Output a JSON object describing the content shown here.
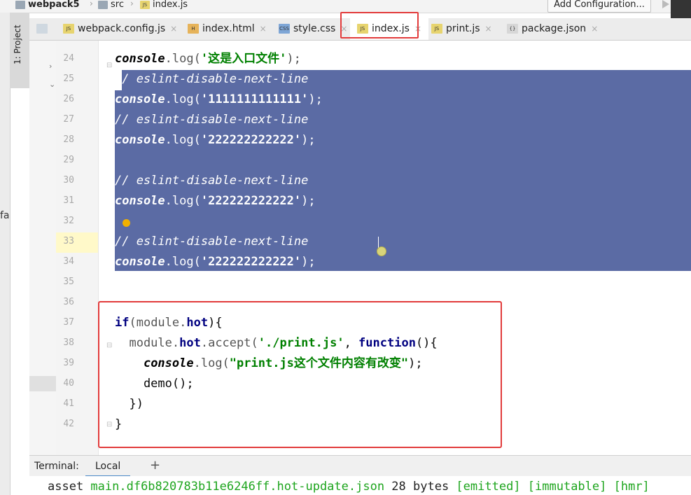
{
  "breadcrumb": [
    "webpack5",
    "src",
    "index.js"
  ],
  "toolbar": {
    "add_configuration": "Add Configuration..."
  },
  "sidebar": {
    "project_label": "1: Project",
    "partial_text": "fa"
  },
  "tabs": [
    {
      "label": "webpack.config.js",
      "icon": "js-file-icon"
    },
    {
      "label": "index.html",
      "icon": "html-file-icon"
    },
    {
      "label": "style.css",
      "icon": "css-file-icon"
    },
    {
      "label": "index.js",
      "icon": "js-file-icon",
      "active": true
    },
    {
      "label": "print.js",
      "icon": "js-file-icon"
    },
    {
      "label": "package.json",
      "icon": "json-file-icon"
    }
  ],
  "tab_close_symbol": "×",
  "editor": {
    "line_numbers": [
      "24",
      "25",
      "26",
      "27",
      "28",
      "29",
      "30",
      "31",
      "32",
      "33",
      "34",
      "35",
      "36",
      "37",
      "38",
      "39",
      "40",
      "41",
      "42"
    ],
    "code": {
      "l24_obj": "console",
      "l24_fn": ".log(",
      "l24_str": "'这是入口文件'",
      "l24_end": ");",
      "l25_cmt": "// eslint-disable-next-line",
      "l26_obj": "console",
      "l26_fn": ".log(",
      "l26_str": "'1111111111111'",
      "l26_end": ");",
      "l27_cmt": "// eslint-disable-next-line",
      "l28_obj": "console",
      "l28_fn": ".log(",
      "l28_str": "'222222222222'",
      "l28_end": ");",
      "l30_cmt": "// eslint-disable-next-line",
      "l31_obj": "console",
      "l31_fn": ".log(",
      "l31_str": "'222222222222'",
      "l31_end": ");",
      "l33_cmt": "// eslint-disable-next-line",
      "l34_obj": "console",
      "l34_fn": ".log(",
      "l34_str": "'222222222222'",
      "l34_end": ");",
      "l37_kw": "if",
      "l37_rest": "(module.",
      "l37_hot": "hot",
      "l37_end": "){",
      "l38_a": "  module.",
      "l38_hot": "hot",
      "l38_b": ".accept(",
      "l38_str": "'./print.js'",
      "l38_c": ", ",
      "l38_kw": "function",
      "l38_d": "(){",
      "l39_pre": "    ",
      "l39_obj": "console",
      "l39_fn": ".log(",
      "l39_str": "\"print.js这个文件内容有改变\"",
      "l39_end": ");",
      "l40": "    demo();",
      "l41": "  })",
      "l42": "}"
    }
  },
  "terminal": {
    "title": "Terminal:",
    "tab": "Local",
    "add_symbol": "+",
    "output": {
      "asset": "asset ",
      "file": "main.df6b820783b11e6246ff.hot-update.json",
      "size": " 28 bytes ",
      "emitted": "[emitted]",
      "immutable": " [immutable]",
      "hmr": " [hmr]"
    }
  },
  "colors": {
    "selection": "#5b6ba4",
    "annotation_red": "#e23b3b",
    "string_green": "#008000",
    "keyword_navy": "#000080"
  }
}
